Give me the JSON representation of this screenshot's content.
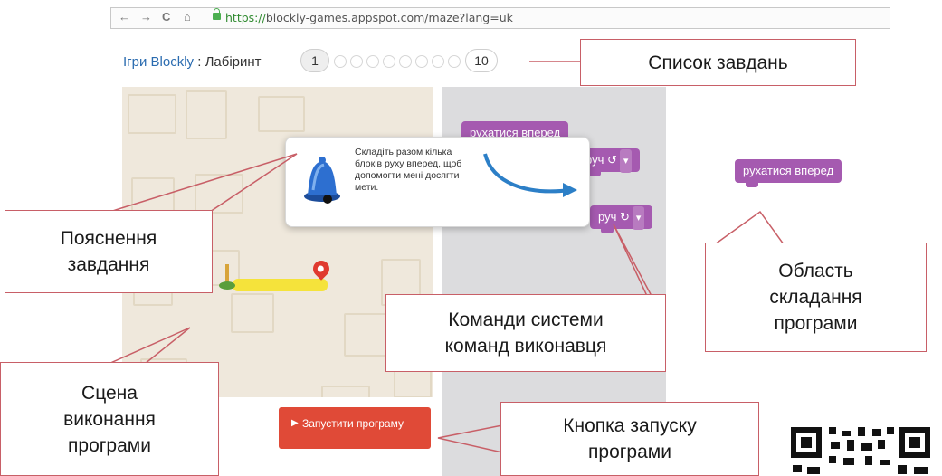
{
  "browser": {
    "back_icon": "←",
    "forward_icon": "→",
    "reload_icon": "C",
    "home_icon": "⌂",
    "url_scheme": "https://",
    "url_host": "blockly-games.appspot.com",
    "url_path": "/maze?lang=uk"
  },
  "app": {
    "title_link": "Ігри Blockly",
    "separator": " : ",
    "title": "Лабіринт",
    "levels": {
      "current": "1",
      "last": "10"
    }
  },
  "hint": {
    "text": "Складіть разом кілька блоків руху вперед, щоб допомогти мені досягти мети."
  },
  "toolbox": {
    "block1": "рухатися вперед",
    "block2_visible": "руч ↺",
    "block3_visible": "руч ↻",
    "dropdown": "▾"
  },
  "workspace": {
    "block1": "рухатися вперед"
  },
  "run_button": {
    "icon": "▶",
    "label": "Запустити програму"
  },
  "callouts": {
    "task_list": "Список завдань",
    "task_explanation": "Пояснення завдання",
    "executor_commands": "Команди системи команд виконавця",
    "program_area": "Область складання програми",
    "scene": "Сцена виконання програми",
    "run_button": "Кнопка запуску програми"
  },
  "colors": {
    "block": "#a55ab0",
    "run": "#e04a37",
    "callout_border": "#c85f67",
    "toolbox": "#dcdcde",
    "maze": "#efe8dc"
  }
}
